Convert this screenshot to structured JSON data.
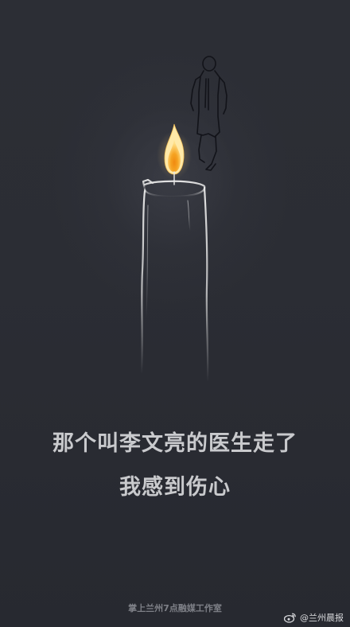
{
  "headline": {
    "line1": "那个叫李文亮的医生走了",
    "line2": "我感到伤心"
  },
  "footer": {
    "studio": "掌上兰州7点融媒工作室"
  },
  "watermark": {
    "icon": "weibo-logo-icon",
    "text": "@兰州晨报"
  },
  "colors": {
    "background": "#2a2c33",
    "headline": "#c9cacd",
    "candle_outline": "#e6e6e6",
    "flame_outer": "#ffd36a",
    "flame_inner": "#f39a12"
  }
}
